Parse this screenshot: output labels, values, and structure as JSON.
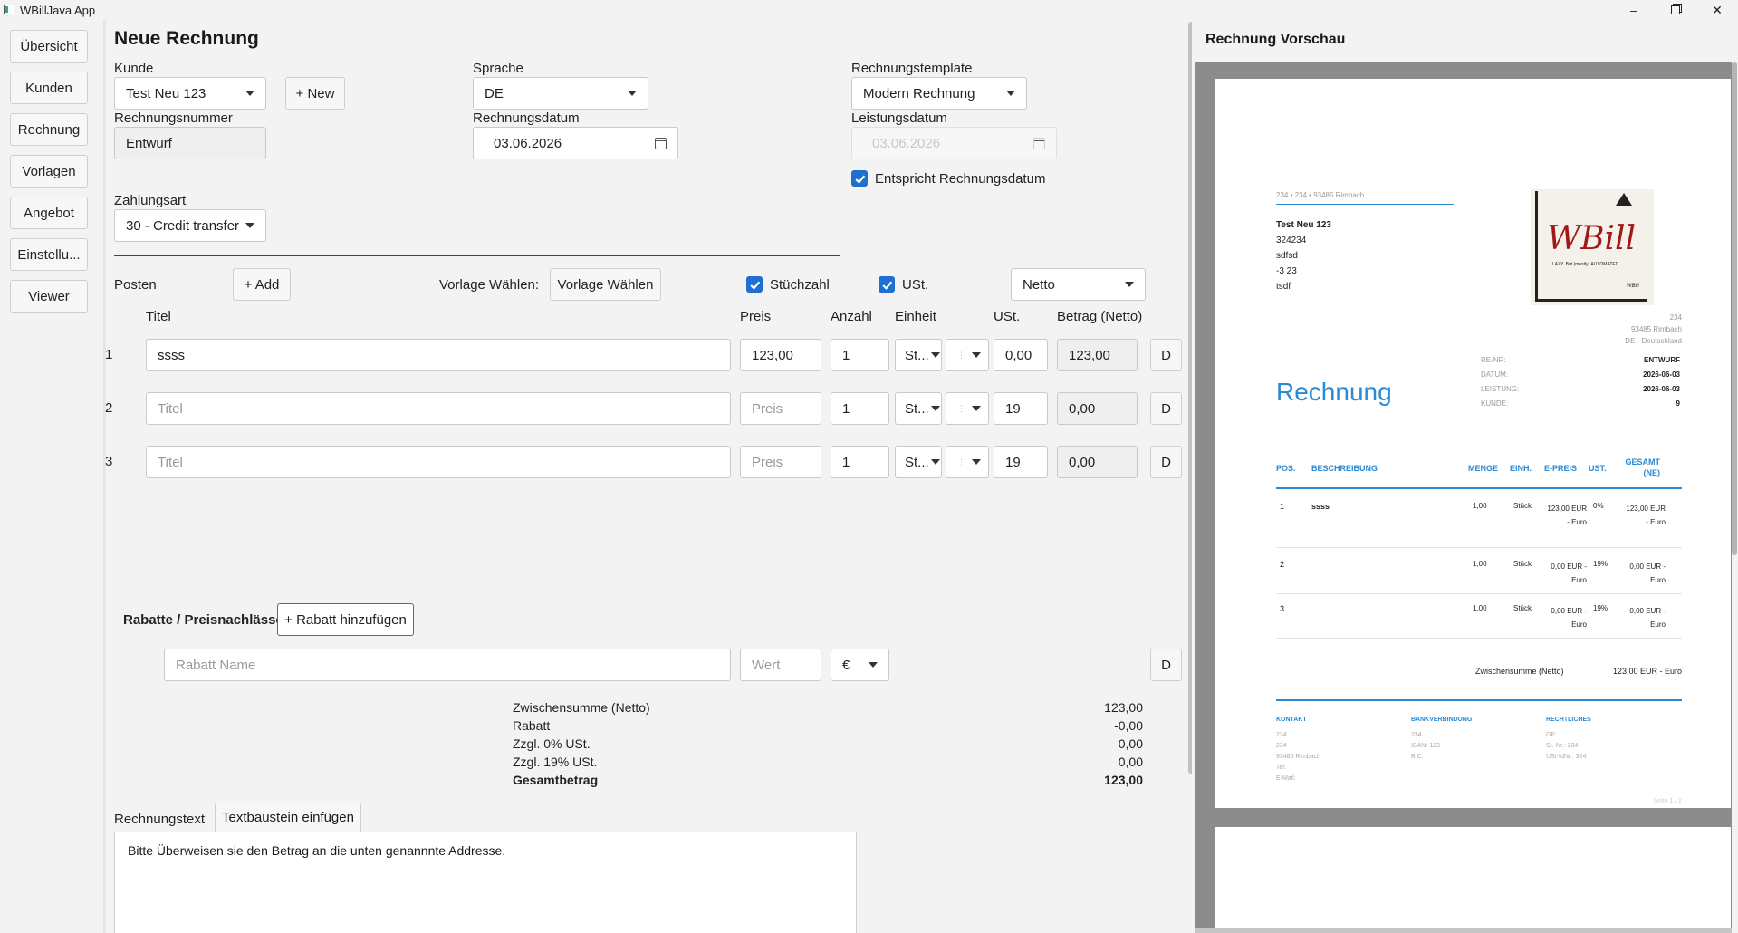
{
  "window": {
    "title": "WBillJava App"
  },
  "sidebar": {
    "items": [
      "Übersicht",
      "Kunden",
      "Rechnung",
      "Vorlagen",
      "Angebot",
      "Einstellu...",
      "Viewer"
    ]
  },
  "form": {
    "heading": "Neue Rechnung",
    "kunde": {
      "label": "Kunde",
      "value": "Test Neu 123",
      "new_button": "+ New"
    },
    "sprache": {
      "label": "Sprache",
      "value": "DE"
    },
    "template": {
      "label": "Rechnungstemplate",
      "value": "Modern Rechnung"
    },
    "rechnungsnummer": {
      "label": "Rechnungsnummer",
      "value": "Entwurf"
    },
    "rechnungsdatum": {
      "label": "Rechnungsdatum",
      "value": "03.06.2026"
    },
    "leistungsdatum": {
      "label": "Leistungsdatum",
      "value": "03.06.2026",
      "checkbox_label": "Entspricht Rechnungsdatum"
    },
    "zahlungsart": {
      "label": "Zahlungsart",
      "value": "30 - Credit transfer"
    }
  },
  "posten": {
    "label": "Posten",
    "add_button": "+ Add",
    "vorlage_label": "Vorlage Wählen:",
    "vorlage_button": "Vorlage Wählen",
    "stueckzahl_label": "Stüchzahl",
    "ust_label": "USt.",
    "mode_value": "Netto",
    "columns": {
      "titel": "Titel",
      "preis": "Preis",
      "anzahl": "Anzahl",
      "einheit": "Einheit",
      "ust": "USt.",
      "betrag": "Betrag (Netto)"
    },
    "rows": [
      {
        "num": "1",
        "titel": "ssss",
        "titel_ph": "Titel",
        "preis": "123,00",
        "preis_ph": "Preis",
        "anzahl": "1",
        "einheit": "St...",
        "extra": "",
        "ust": "0,00",
        "betrag": "123,00",
        "d": "D"
      },
      {
        "num": "2",
        "titel": "",
        "titel_ph": "Titel",
        "preis": "",
        "preis_ph": "Preis",
        "anzahl": "1",
        "einheit": "St...",
        "extra": "",
        "ust": "19",
        "betrag": "0,00",
        "d": "D"
      },
      {
        "num": "3",
        "titel": "",
        "titel_ph": "Titel",
        "preis": "",
        "preis_ph": "Preis",
        "anzahl": "1",
        "einheit": "St...",
        "extra": "",
        "ust": "19",
        "betrag": "0,00",
        "d": "D"
      }
    ]
  },
  "rabatt": {
    "label": "Rabatte / Preisnachlässe",
    "add_button": "+ Rabatt hinzufügen",
    "name_placeholder": "Rabatt Name",
    "wert_placeholder": "Wert",
    "currency": "€",
    "d": "D"
  },
  "summary": [
    {
      "label": "Zwischensumme (Netto)",
      "value": "123,00"
    },
    {
      "label": "Rabatt",
      "value": "-0,00"
    },
    {
      "label": "Zzgl. 0% USt.",
      "value": "0,00"
    },
    {
      "label": "Zzgl. 19% USt.",
      "value": "0,00"
    },
    {
      "label": "Gesamtbetrag",
      "value": "123,00"
    }
  ],
  "rechnungstext": {
    "label": "Rechnungstext",
    "textbaustein_button": "Textbaustein einfügen",
    "text": "Bitte Überweisen sie den Betrag an die unten genannnte Addresse."
  },
  "preview": {
    "title": "Rechnung Vorschau",
    "sender_line": "234 • 234 • 93485 Rimbach",
    "recipient": [
      "Test Neu 123",
      "324234",
      "sdfsd",
      "-3 23",
      "tsdf"
    ],
    "logo": {
      "text": "WBill",
      "tagline": "LAZY. But (mostly) AUTOMATED.",
      "signature": "WBill"
    },
    "sender_address": [
      "234",
      "93485 Rimbach",
      "DE - Deutschland"
    ],
    "meta": [
      {
        "label": "RE-NR:",
        "value": "ENTWURF"
      },
      {
        "label": "DATUM:",
        "value": "2026-06-03"
      },
      {
        "label": "LEISTUNG:",
        "value": "2026-06-03"
      },
      {
        "label": "KUNDE:",
        "value": "9"
      }
    ],
    "doc_title": "Rechnung",
    "table_headers": [
      "POS.",
      "BESCHREIBUNG",
      "MENGE",
      "EINH.",
      "E-PREIS",
      "UST.",
      "GESAMT (NE)"
    ],
    "rows": [
      {
        "pos": "1",
        "desc": "ssss",
        "menge": "1,00",
        "einh": "Stück",
        "epreis": "123,00 EUR - Euro",
        "ust": "0%",
        "gesamt": "123,00 EUR - Euro"
      },
      {
        "pos": "2",
        "desc": "",
        "menge": "1,00",
        "einh": "Stück",
        "epreis": "0,00 EUR - Euro",
        "ust": "19%",
        "gesamt": "0,00 EUR - Euro"
      },
      {
        "pos": "3",
        "desc": "",
        "menge": "1,00",
        "einh": "Stück",
        "epreis": "0,00 EUR - Euro",
        "ust": "19%",
        "gesamt": "0,00 EUR - Euro"
      }
    ],
    "subtotal_label": "Zwischensumme (Netto)",
    "subtotal_value": "123,00 EUR - Euro",
    "footer": {
      "kontakt": {
        "title": "KONTAKT",
        "lines": [
          "234",
          "234",
          "93485 Rimbach",
          "Tel:",
          "E-Mail:"
        ]
      },
      "bank": {
        "title": "BANKVERBINDUNG",
        "lines": [
          "234",
          "IBAN: 123",
          "BIC:"
        ]
      },
      "recht": {
        "title": "RECHTLICHES",
        "lines": [
          "GF:",
          "St.-Nr.: 234",
          "USt-IdNr.: 324"
        ]
      }
    },
    "page_label": "Seite 1 / 2"
  },
  "colors": {
    "accent": "#1f6fd1",
    "preview_blue": "#2a8ad3",
    "preview_bg": "#8c8c8c"
  }
}
